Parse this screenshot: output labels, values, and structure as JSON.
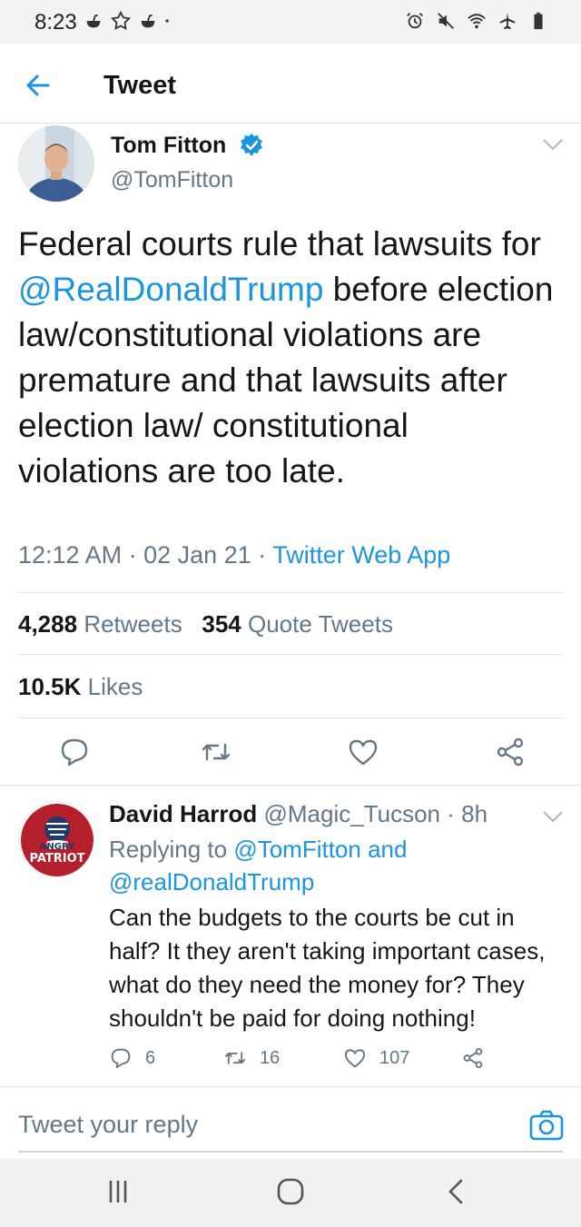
{
  "status_bar": {
    "time": "8:23",
    "left_icons": [
      "notification-icon",
      "settings-icon",
      "notification-icon",
      "dot-icon"
    ],
    "right_icons": [
      "alarm-icon",
      "mute-icon",
      "wifi-icon",
      "airplane-icon",
      "battery-icon"
    ]
  },
  "header": {
    "title": "Tweet",
    "back_icon": "back-arrow-icon"
  },
  "tweet": {
    "author_name": "Tom Fitton",
    "author_handle": "@TomFitton",
    "verified": true,
    "text_part1": "Federal courts rule that lawsuits for ",
    "mention": "@RealDonaldTrump",
    "text_part2": " before election law/constitutional violations are premature and that lawsuits after election law/ constitutional violations are too late.",
    "time": "12:12 AM",
    "date": "02 Jan 21",
    "source": "Twitter Web App",
    "retweets_count": "4,288",
    "retweets_label": "Retweets",
    "quotes_count": "354",
    "quotes_label": "Quote Tweets",
    "likes_count": "10.5K",
    "likes_label": "Likes"
  },
  "reply": {
    "name": "David Harrod",
    "handle": "@Magic_Tucson",
    "age": "8h",
    "replying_label": "Replying to",
    "replying_to_1": "@TomFitton",
    "replying_and": "and",
    "replying_to_2": "@realDonaldTrump",
    "text": "Can the budgets to the courts be cut in half? It they aren't taking important cases, what do they need the money for? They shouldn't be paid for doing nothing!",
    "reply_count": "6",
    "retweet_count": "16",
    "like_count": "107",
    "avatar_text_top": "ANGRY",
    "avatar_text_bottom": "PATRIOT"
  },
  "compose": {
    "placeholder": "Tweet your reply"
  },
  "colors": {
    "accent": "#1b95e0",
    "secondary_text": "#657786",
    "primary_text": "#14171a"
  }
}
